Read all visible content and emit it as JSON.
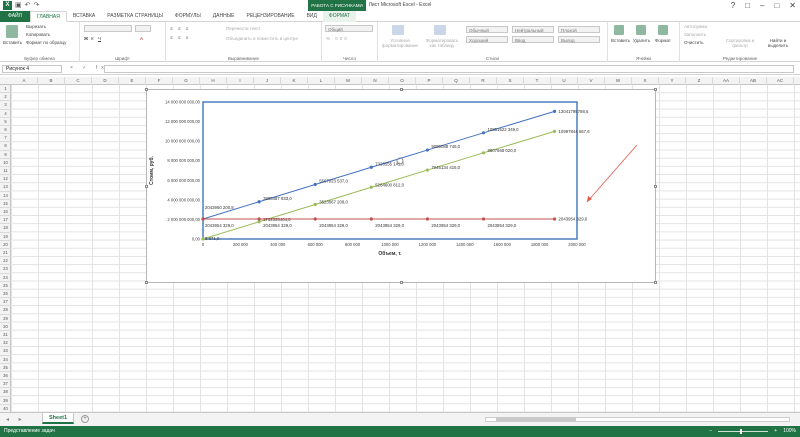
{
  "window": {
    "title": "Лист Microsoft Excel - Excel",
    "context_group": "РАБОТА С РИСУНКАМИ",
    "controls": [
      "?",
      "□",
      "–",
      "□",
      "✕"
    ]
  },
  "qat": {
    "logo": "X",
    "undo": "↶",
    "redo": "↷"
  },
  "tabs": [
    {
      "label": "ФАЙЛ",
      "kind": "file"
    },
    {
      "label": "ГЛАВНАЯ",
      "kind": "active"
    },
    {
      "label": "ВСТАВКА",
      "kind": ""
    },
    {
      "label": "РАЗМЕТКА СТРАНИЦЫ",
      "kind": ""
    },
    {
      "label": "ФОРМУЛЫ",
      "kind": ""
    },
    {
      "label": "ДАННЫЕ",
      "kind": ""
    },
    {
      "label": "РЕЦЕНЗИРОВАНИЕ",
      "kind": ""
    },
    {
      "label": "ВИД",
      "kind": ""
    },
    {
      "label": "ФОРМАТ",
      "kind": "ctx"
    }
  ],
  "ribbon": {
    "clipboard": {
      "label": "Буфер обмена",
      "paste": "Вставить",
      "cut": "Вырезать",
      "copy": "Копировать",
      "format_painter": "Формат по образцу"
    },
    "font": {
      "label": "Шрифт"
    },
    "alignment": {
      "label": "Выравнивание",
      "wrap": "Перенести текст",
      "merge": "Объединить и поместить в центре"
    },
    "number": {
      "label": "Число",
      "format": "Общий"
    },
    "styles": {
      "label": "Стили",
      "conditional": "Условное форматирование",
      "as_table": "Форматировать как таблицу",
      "cells": [
        "Обычный",
        "Нейтральный",
        "Плохой",
        "Хороший",
        "Ввод",
        "Вывод"
      ]
    },
    "cells": {
      "label": "Ячейки",
      "insert": "Вставить",
      "delete": "Удалить",
      "format": "Формат"
    },
    "editing": {
      "label": "Редактирование",
      "autosum": "Автосумма",
      "fill": "Заполнить",
      "clear": "Очистить",
      "sort": "Сортировка и фильтр",
      "find": "Найти и выделить"
    }
  },
  "formula_bar": {
    "name_box": "Рисунок 4",
    "fx": "× ✓ fx",
    "value": ""
  },
  "columns": [
    "A",
    "B",
    "C",
    "D",
    "E",
    "F",
    "G",
    "H",
    "I",
    "J",
    "K",
    "L",
    "M",
    "N",
    "O",
    "P",
    "Q",
    "R",
    "S",
    "T",
    "U",
    "V",
    "W",
    "X",
    "Y",
    "Z",
    "AA",
    "AB",
    "AC"
  ],
  "rows": [
    "1",
    "2",
    "3",
    "4",
    "5",
    "6",
    "7",
    "8",
    "9",
    "10",
    "11",
    "12",
    "13",
    "14",
    "15",
    "16",
    "17",
    "18",
    "19",
    "20",
    "21",
    "22",
    "23",
    "24",
    "25",
    "26",
    "27",
    "28",
    "29",
    "30",
    "31",
    "32",
    "33",
    "34",
    "35",
    "36",
    "37",
    "38",
    "39",
    "40"
  ],
  "chart_data": {
    "type": "line",
    "xlabel": "Объем, т.",
    "ylabel": "Стоим, руб.",
    "xlim": [
      0,
      2000000
    ],
    "ylim": [
      0,
      14000000000
    ],
    "x_ticks": [
      "0",
      "200 000",
      "400 000",
      "600 000",
      "800 000",
      "1000 000",
      "1200 000",
      "1400 000",
      "1600 000",
      "1800 000",
      "2000 000"
    ],
    "y_ticks": [
      "0,00",
      "2 000 000 000,00",
      "4 000 000 000,00",
      "6 000 000 000,00",
      "8 000 000 000,00",
      "10 000 000 000,00",
      "12 000 000 000,00",
      "14 000 000 000,00"
    ],
    "series": [
      {
        "color": "#4472c4",
        "x": [
          0,
          300000,
          600000,
          900000,
          1200000,
          1500000,
          1880000
        ],
        "y": [
          2043960200,
          3805487933,
          5567023537,
          7328555141,
          9090088745,
          10851622349,
          13041795798.6
        ],
        "labels": [
          "2043960 200,8",
          "3805487 933,0",
          "5567023 537,0",
          "7328555 141,0",
          "9090088 745,0",
          "10851622 349,0",
          "13041795798,6"
        ]
      },
      {
        "color": "#9bbb59",
        "x": [
          0,
          300000,
          600000,
          900000,
          1200000,
          1500000,
          1880000
        ],
        "y": [
          5871,
          1762335404,
          3523067208,
          5284600812,
          7046134416,
          8807668020,
          10997844667.6
        ],
        "labels": [
          "5 871,0",
          "1762335404,0",
          "3523067 208,0",
          "5284600 812,0",
          "7046134 416,0",
          "8807668 020,0",
          "10997844 667,6"
        ]
      },
      {
        "color": "#c0504d",
        "x": [
          0,
          300000,
          600000,
          900000,
          1200000,
          1500000,
          1880000
        ],
        "y": [
          2043954329,
          2043954329,
          2043954329,
          2043954329,
          2043954329,
          2043954329,
          2043954329
        ],
        "labels": [
          "2043954 329,0",
          "2043954 329,0",
          "2043954 329,0",
          "2043954 329,0",
          "2043954 329,0",
          "2043954 329,0",
          "2043954 329,0"
        ]
      }
    ],
    "grid": false,
    "legend": "none"
  },
  "sheet_tabs": [
    {
      "label": "Sheet1"
    }
  ],
  "status": {
    "left": "Представление задач",
    "zoom": "100%"
  }
}
